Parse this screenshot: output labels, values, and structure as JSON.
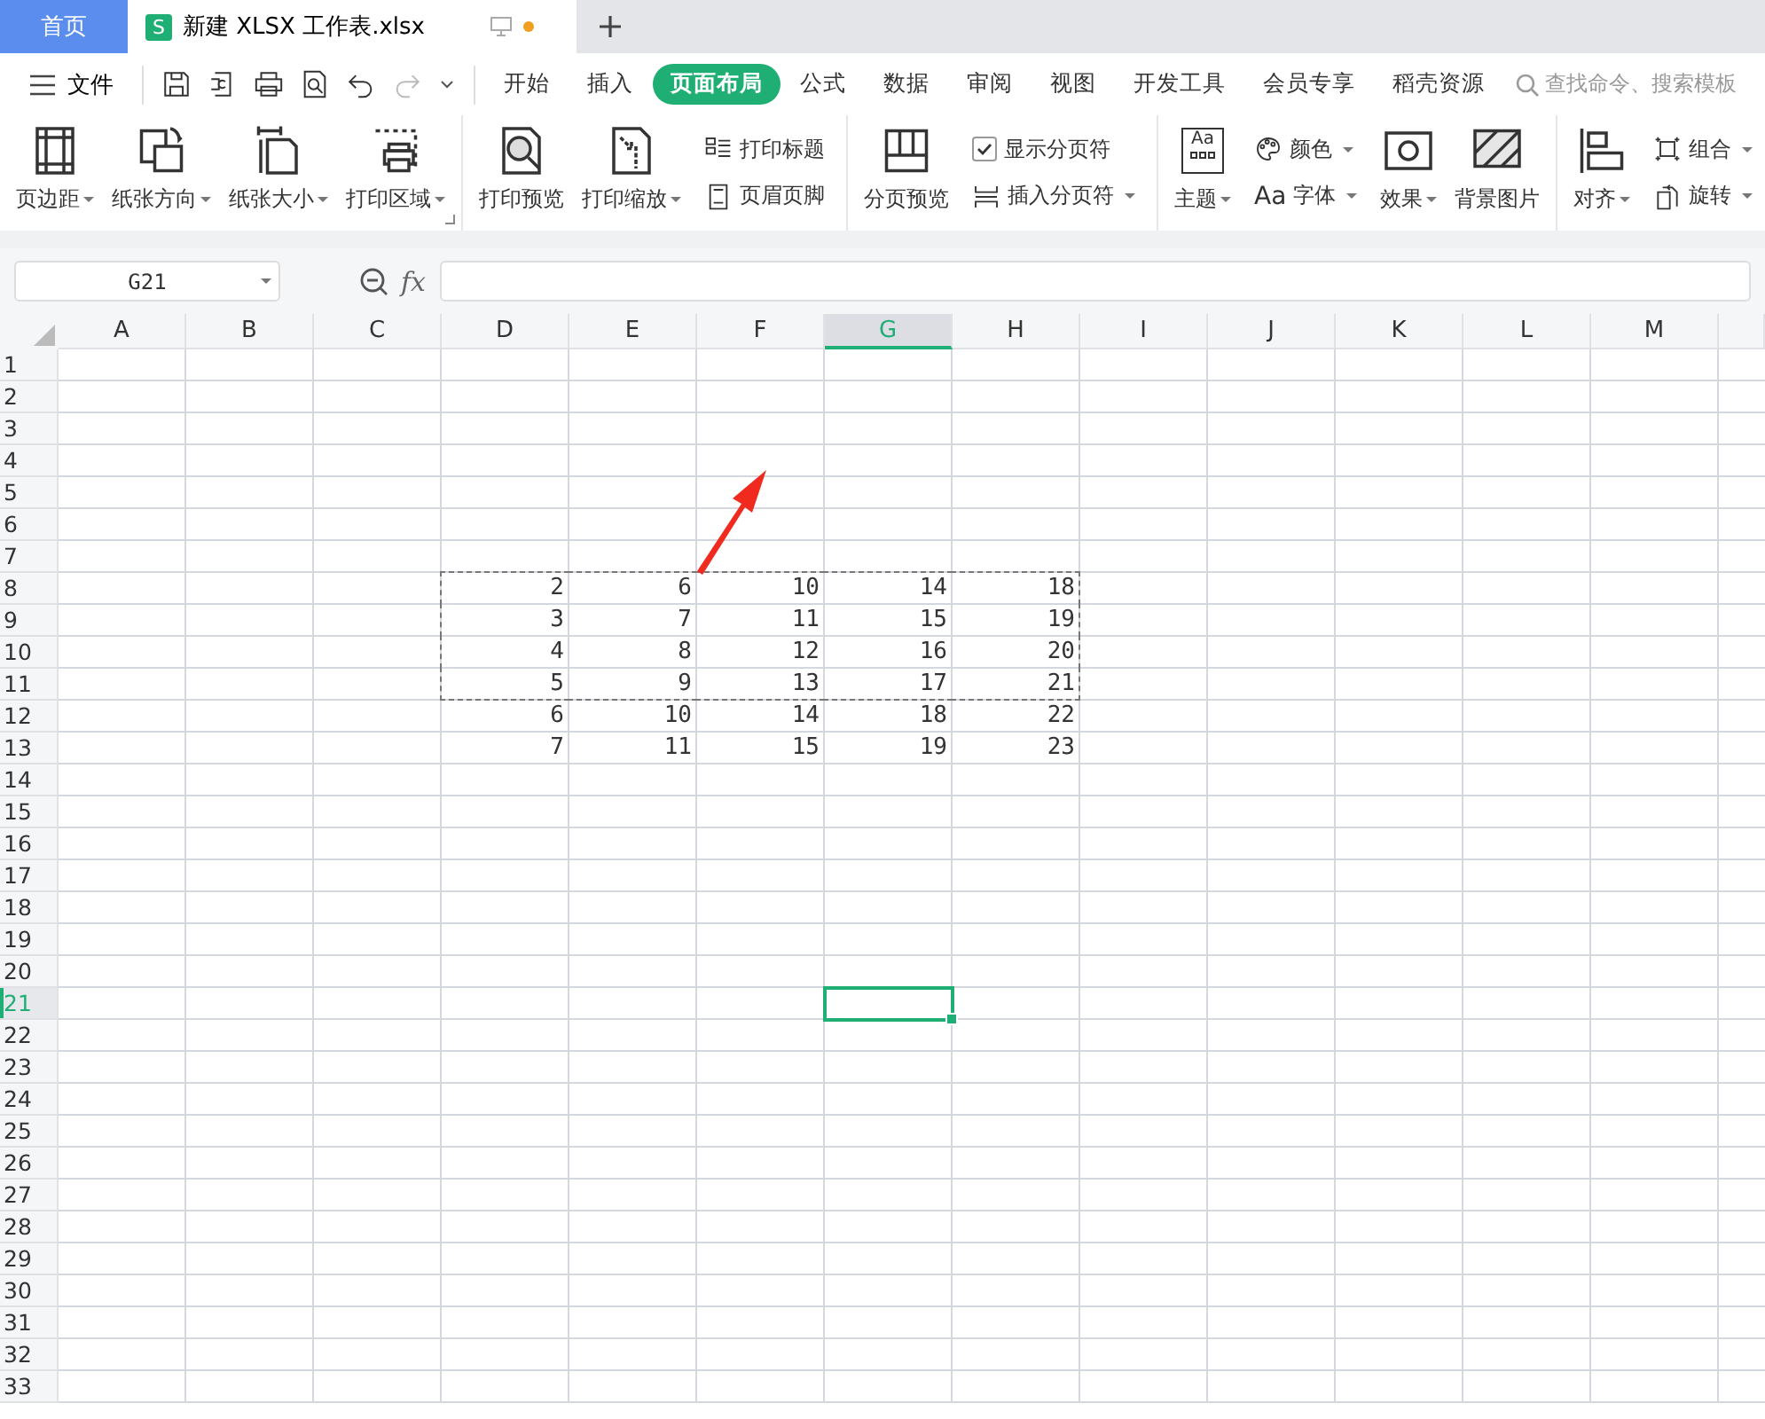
{
  "tabs": [
    {
      "label": "首页",
      "selected": false
    },
    {
      "label": "新建 XLSX 工作表.xlsx",
      "badge": "S",
      "selected": true,
      "modified": true
    }
  ],
  "menu": {
    "file_label": "文件",
    "ribbon_tabs": [
      {
        "label": "开始",
        "selected": false
      },
      {
        "label": "插入",
        "selected": false
      },
      {
        "label": "页面布局",
        "selected": true
      },
      {
        "label": "公式",
        "selected": false
      },
      {
        "label": "数据",
        "selected": false
      },
      {
        "label": "审阅",
        "selected": false
      },
      {
        "label": "视图",
        "selected": false
      },
      {
        "label": "开发工具",
        "selected": false
      },
      {
        "label": "会员专享",
        "selected": false
      },
      {
        "label": "稻壳资源",
        "selected": false
      }
    ],
    "search": {
      "placeholder": "查找命令、搜索模板"
    }
  },
  "ribbon": {
    "groups": [
      {
        "launcher": true,
        "items": [
          {
            "kind": "large",
            "label": "页边距",
            "dropdown": true
          },
          {
            "kind": "large",
            "label": "纸张方向",
            "dropdown": true
          },
          {
            "kind": "large",
            "label": "纸张大小",
            "dropdown": true
          },
          {
            "kind": "large",
            "label": "打印区域",
            "dropdown": true
          }
        ]
      },
      {
        "items": [
          {
            "kind": "large",
            "label": "打印预览"
          },
          {
            "kind": "large",
            "label": "打印缩放",
            "dropdown": true
          },
          {
            "kind": "stack",
            "items": [
              {
                "kind": "small",
                "label": "打印标题"
              },
              {
                "kind": "small",
                "label": "页眉页脚"
              }
            ]
          }
        ]
      },
      {
        "items": [
          {
            "kind": "large",
            "label": "分页预览"
          },
          {
            "kind": "stack",
            "items": [
              {
                "kind": "check",
                "label": "显示分页符",
                "checked": true
              },
              {
                "kind": "small",
                "label": "插入分页符",
                "dropdown": true
              }
            ]
          }
        ]
      },
      {
        "items": [
          {
            "kind": "large",
            "label": "主题",
            "icon_text": "Aa",
            "dropdown": true
          },
          {
            "kind": "stack",
            "items": [
              {
                "kind": "small",
                "label": "颜色",
                "dropdown": true
              },
              {
                "kind": "small",
                "label": "字体",
                "icon_text": "Aa",
                "dropdown": true
              }
            ]
          },
          {
            "kind": "large",
            "label": "效果",
            "dropdown": true
          },
          {
            "kind": "large",
            "label": "背景图片"
          }
        ]
      },
      {
        "items": [
          {
            "kind": "large",
            "label": "对齐",
            "dropdown": true
          },
          {
            "kind": "stack",
            "items": [
              {
                "kind": "small",
                "label": "组合",
                "dropdown": true
              },
              {
                "kind": "small",
                "label": "旋转",
                "dropdown": true
              }
            ]
          }
        ]
      }
    ]
  },
  "formula_bar": {
    "name_box": "G21",
    "function_label": "fx"
  },
  "sheet": {
    "columns": [
      {
        "label": "A",
        "selected": false,
        "copy_marked": false
      },
      {
        "label": "B",
        "selected": false,
        "copy_marked": false
      },
      {
        "label": "C",
        "selected": false,
        "copy_marked": false
      },
      {
        "label": "D",
        "selected": false,
        "copy_marked": true
      },
      {
        "label": "E",
        "selected": false,
        "copy_marked": true
      },
      {
        "label": "F",
        "selected": false,
        "copy_marked": true
      },
      {
        "label": "G",
        "selected": true,
        "copy_marked": true
      },
      {
        "label": "H",
        "selected": false,
        "copy_marked": true
      },
      {
        "label": "I",
        "selected": false,
        "copy_marked": false
      },
      {
        "label": "J",
        "selected": false,
        "copy_marked": false
      },
      {
        "label": "K",
        "selected": false,
        "copy_marked": false
      },
      {
        "label": "L",
        "selected": false,
        "copy_marked": false
      },
      {
        "label": "M",
        "selected": false,
        "copy_marked": false
      }
    ],
    "rows": [
      {
        "label": "1",
        "selected": false,
        "copy_marked": false
      },
      {
        "label": "2",
        "selected": false,
        "copy_marked": false
      },
      {
        "label": "3",
        "selected": false,
        "copy_marked": false
      },
      {
        "label": "4",
        "selected": false,
        "copy_marked": false
      },
      {
        "label": "5",
        "selected": false,
        "copy_marked": false
      },
      {
        "label": "6",
        "selected": false,
        "copy_marked": false
      },
      {
        "label": "7",
        "selected": false,
        "copy_marked": false
      },
      {
        "label": "8",
        "selected": false,
        "copy_marked": true,
        "cells": [
          null,
          null,
          null,
          "2",
          "6",
          "10",
          "14",
          "18"
        ]
      },
      {
        "label": "9",
        "selected": false,
        "copy_marked": true,
        "cells": [
          null,
          null,
          null,
          "3",
          "7",
          "11",
          "15",
          "19"
        ]
      },
      {
        "label": "10",
        "selected": false,
        "copy_marked": true,
        "cells": [
          null,
          null,
          null,
          "4",
          "8",
          "12",
          "16",
          "20"
        ]
      },
      {
        "label": "11",
        "selected": false,
        "copy_marked": true,
        "cells": [
          null,
          null,
          null,
          "5",
          "9",
          "13",
          "17",
          "21"
        ]
      },
      {
        "label": "12",
        "selected": false,
        "copy_marked": false,
        "cells": [
          null,
          null,
          null,
          "6",
          "10",
          "14",
          "18",
          "22"
        ]
      },
      {
        "label": "13",
        "selected": false,
        "copy_marked": false,
        "cells": [
          null,
          null,
          null,
          "7",
          "11",
          "15",
          "19",
          "23"
        ]
      },
      {
        "label": "14",
        "selected": false,
        "copy_marked": false
      },
      {
        "label": "15",
        "selected": false,
        "copy_marked": false
      },
      {
        "label": "16",
        "selected": false,
        "copy_marked": false
      },
      {
        "label": "17",
        "selected": false,
        "copy_marked": false
      },
      {
        "label": "18",
        "selected": false,
        "copy_marked": false
      },
      {
        "label": "19",
        "selected": false,
        "copy_marked": false
      },
      {
        "label": "20",
        "selected": false,
        "copy_marked": false
      },
      {
        "label": "21",
        "selected": true,
        "copy_marked": false
      },
      {
        "label": "22",
        "selected": false,
        "copy_marked": false
      },
      {
        "label": "23",
        "selected": false,
        "copy_marked": false
      },
      {
        "label": "24",
        "selected": false,
        "copy_marked": false
      },
      {
        "label": "25",
        "selected": false,
        "copy_marked": false
      },
      {
        "label": "26",
        "selected": false,
        "copy_marked": false
      },
      {
        "label": "27",
        "selected": false,
        "copy_marked": false
      },
      {
        "label": "28",
        "selected": false,
        "copy_marked": false
      },
      {
        "label": "29",
        "selected": false,
        "copy_marked": false
      },
      {
        "label": "30",
        "selected": false,
        "copy_marked": false
      },
      {
        "label": "31",
        "selected": false,
        "copy_marked": false
      },
      {
        "label": "32",
        "selected": false,
        "copy_marked": false
      },
      {
        "label": "33",
        "selected": false,
        "copy_marked": false
      }
    ]
  }
}
